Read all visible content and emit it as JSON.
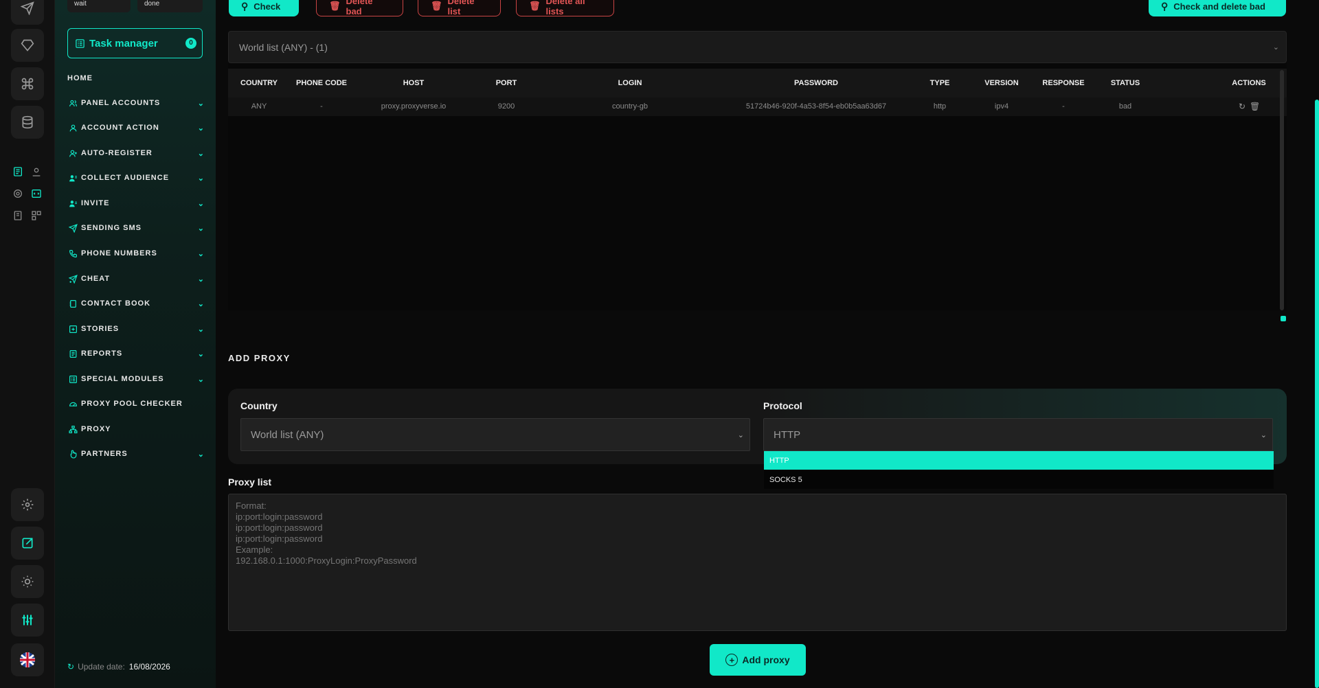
{
  "sidebar": {
    "status_wait": "wait",
    "status_done": "done",
    "task_manager_label": "Task manager",
    "task_manager_count": "0",
    "items": [
      {
        "label": "HOME"
      },
      {
        "label": "PANEL ACCOUNTS"
      },
      {
        "label": "ACCOUNT ACTION"
      },
      {
        "label": "AUTO-REGISTER"
      },
      {
        "label": "COLLECT AUDIENCE"
      },
      {
        "label": "INVITE"
      },
      {
        "label": "SENDING SMS"
      },
      {
        "label": "PHONE NUMBERS"
      },
      {
        "label": "CHEAT"
      },
      {
        "label": "CONTACT BOOK"
      },
      {
        "label": "STORIES"
      },
      {
        "label": "REPORTS"
      },
      {
        "label": "SPECIAL MODULES"
      },
      {
        "label": "PROXY POOL CHECKER"
      },
      {
        "label": "PROXY"
      },
      {
        "label": "PARTNERS"
      }
    ],
    "update_label": "Update date:",
    "update_value": "16/08/2026"
  },
  "toolbar": {
    "check_label": "Check",
    "delete_bad_label": "Delete bad",
    "delete_list_label": "Delete list",
    "delete_all_label": "Delete all lists",
    "check_delete_bad_label": "Check and delete bad"
  },
  "list_select": {
    "value": "World list (ANY) - (1)"
  },
  "table": {
    "columns": [
      "COUNTRY",
      "PHONE CODE",
      "HOST",
      "PORT",
      "LOGIN",
      "PASSWORD",
      "TYPE",
      "VERSION",
      "RESPONSE",
      "STATUS",
      "ACTIONS"
    ],
    "rows": [
      [
        "ANY",
        "-",
        "proxy.proxyverse.io",
        "9200",
        "country-gb",
        "51724b46-920f-4a53-8f54-eb0b5aa63d67",
        "http",
        "ipv4",
        "-",
        "bad"
      ]
    ]
  },
  "add_proxy": {
    "title": "ADD PROXY",
    "country_label": "Country",
    "country_value": "World list (ANY)",
    "protocol_label": "Protocol",
    "protocol_value": "HTTP",
    "protocol_options": [
      "HTTP",
      "SOCKS 5"
    ],
    "proxy_list_label": "Proxy list",
    "proxy_list_placeholder": "Format:\nip:port:login:password\nip:port:login:password\nip:port:login:password\nExample:\n192.168.0.1:1000:ProxyLogin:ProxyPassword",
    "add_button_label": "Add proxy"
  },
  "colors": {
    "accent": "#11e8c8",
    "danger": "#e25555",
    "background": "#0a0a0a"
  }
}
